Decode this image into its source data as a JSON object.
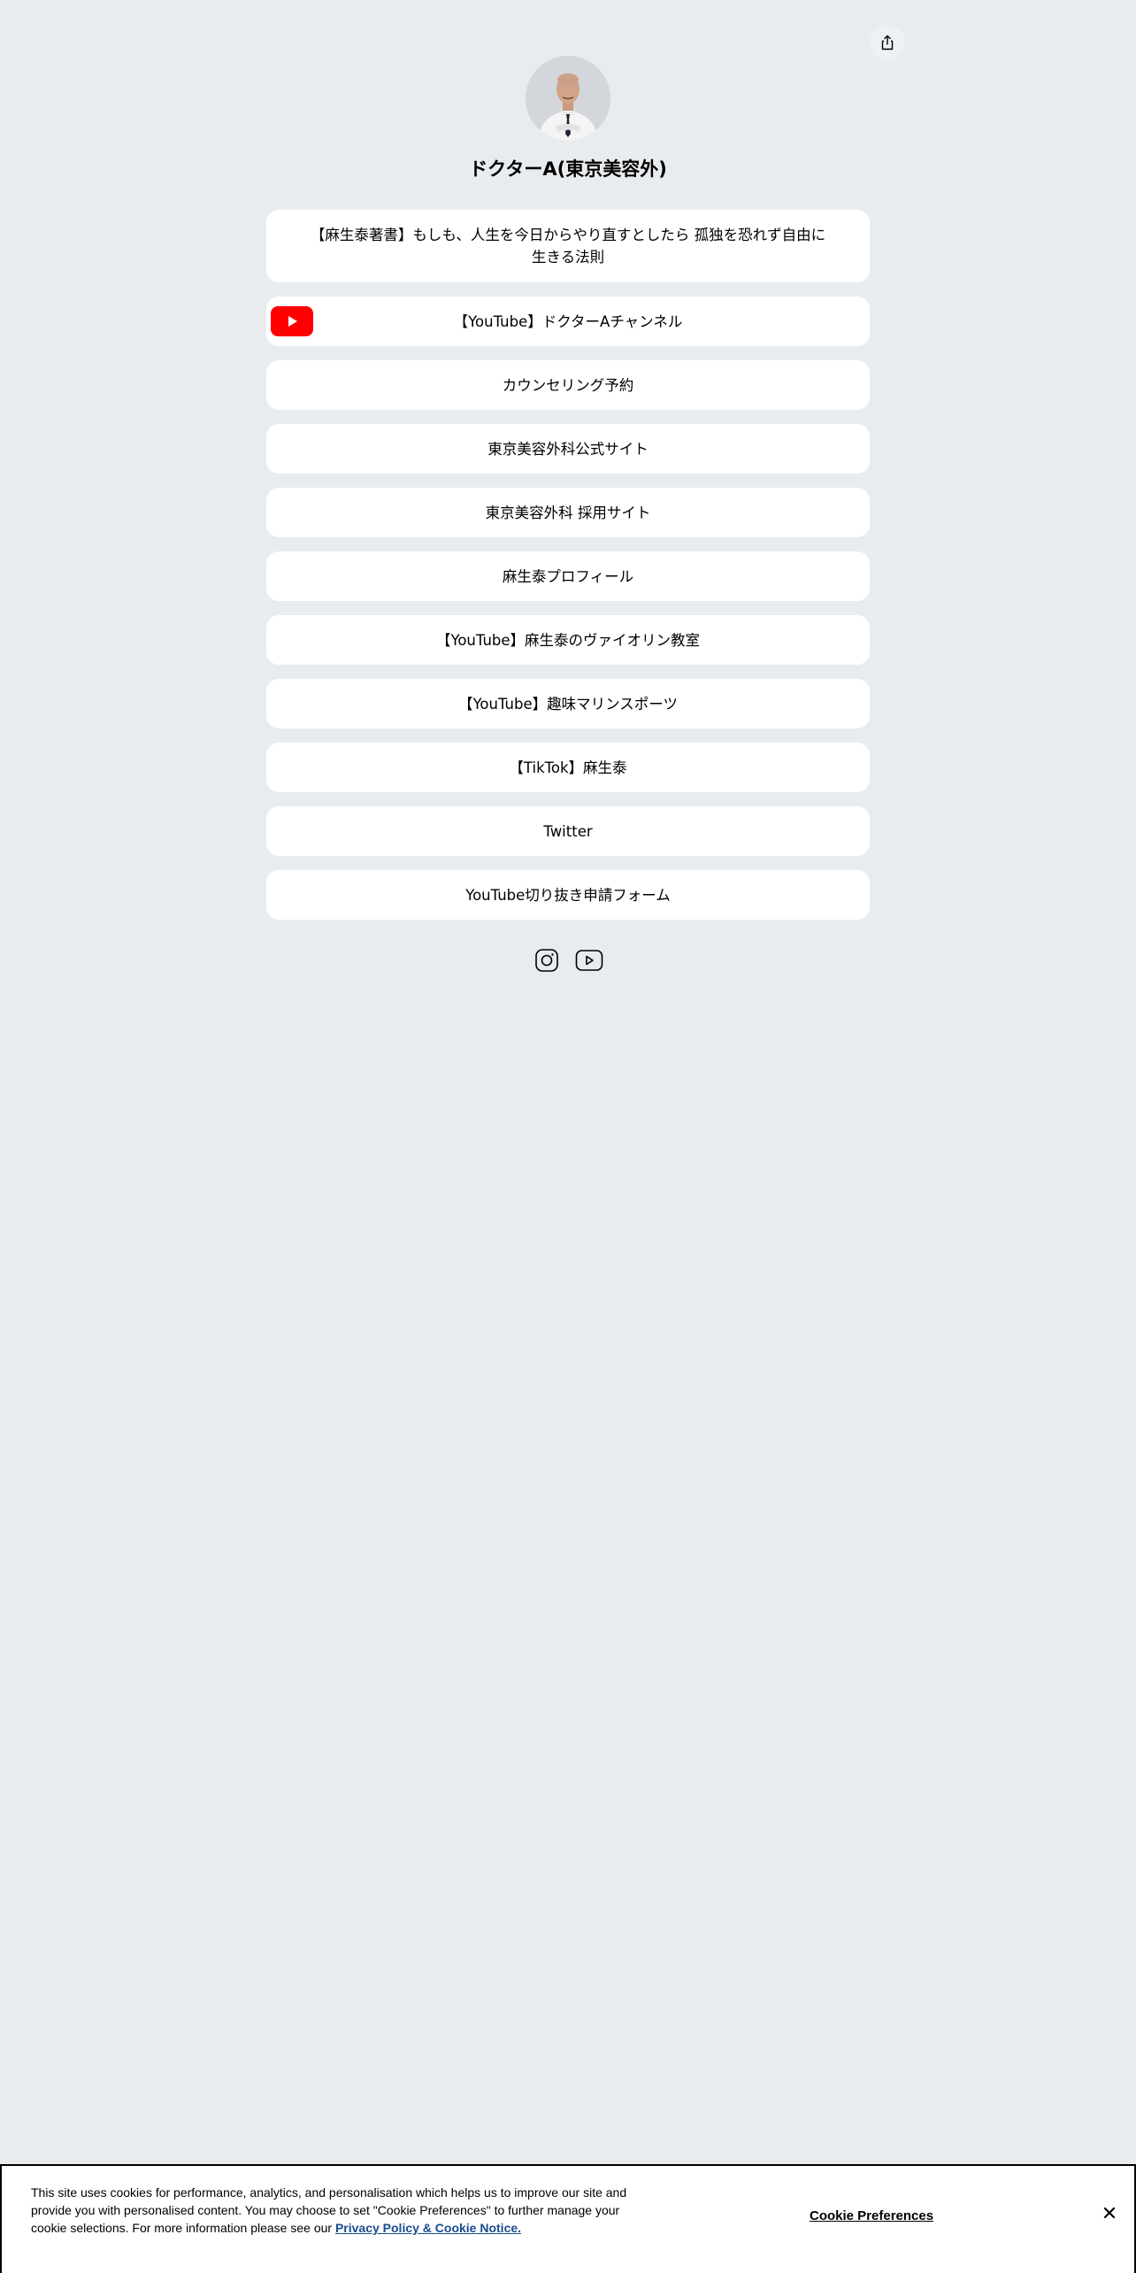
{
  "profile": {
    "name": "ドクターA(東京美容外)"
  },
  "icons": {
    "share": "share-icon",
    "avatar": "doctor-portrait",
    "youtube_thumb": "youtube-logo-icon",
    "instagram": "instagram-icon",
    "youtube": "youtube-icon",
    "close": "close-icon"
  },
  "colors": {
    "background": "#e9ecef",
    "button": "#ffffff",
    "youtube_red": "#ff0000",
    "cookie_link": "#1a4d8f"
  },
  "links": [
    {
      "label": "【麻生泰著書】もしも、人生を今日からやり直すとしたら 孤独を恐れず自由に生きる法則"
    },
    {
      "label": "【YouTube】ドクターAチャンネル"
    },
    {
      "label": "カウンセリング予約"
    },
    {
      "label": "東京美容外科公式サイト"
    },
    {
      "label": "東京美容外科 採用サイト"
    },
    {
      "label": "麻生泰プロフィール"
    },
    {
      "label": "【YouTube】麻生泰のヴァイオリン教室"
    },
    {
      "label": "【YouTube】趣味マリンスポーツ"
    },
    {
      "label": "【TikTok】麻生泰"
    },
    {
      "label": "Twitter"
    },
    {
      "label": "YouTube切り抜き申請フォーム"
    }
  ],
  "cookie": {
    "text": "This site uses cookies for performance, analytics, and personalisation which helps us to improve our site and provide you with personalised content. You may choose to set \"Cookie Preferences\" to further manage your cookie selections. For more information please see our ",
    "link_label": "Privacy Policy & Cookie Notice.",
    "preferences_label": "Cookie Preferences",
    "close_label": "✕"
  }
}
